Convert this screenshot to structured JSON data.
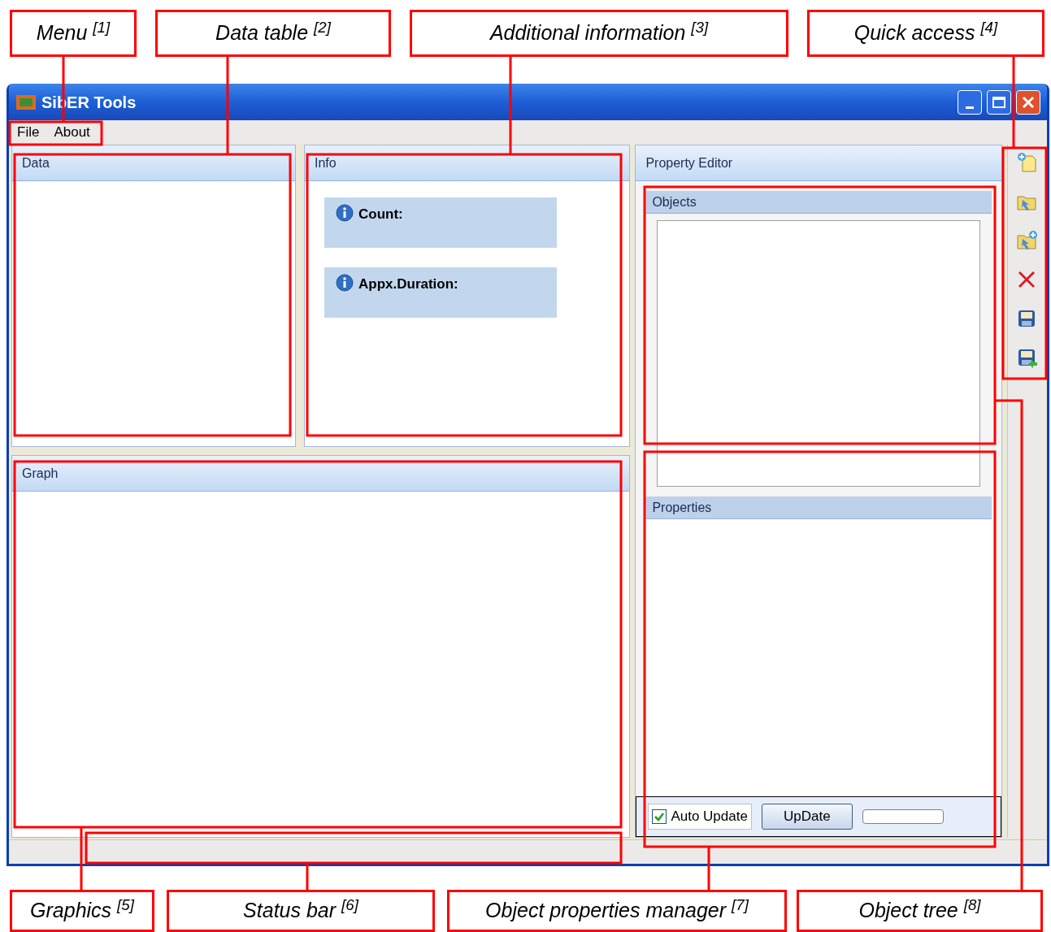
{
  "callouts_top": [
    {
      "text": "Menu $^{[1]}$"
    },
    {
      "text": "Data table $^{[2]}$"
    },
    {
      "text": "Additional information $^{[3]}$"
    },
    {
      "text": "Quick access $^{[4]}$"
    }
  ],
  "window": {
    "title": "SibER Tools"
  },
  "menu": [
    {
      "label": "File"
    },
    {
      "label": "About"
    }
  ],
  "data_panel": {
    "title": "Data"
  },
  "info_panel": {
    "title": "Info",
    "items": [
      {
        "label": "Count:"
      },
      {
        "label": "Appx.Duration:"
      }
    ]
  },
  "graph_panel": {
    "title": "Graph"
  },
  "property_editor": {
    "title": "Property Editor",
    "objects": {
      "title": "Objects"
    },
    "properties": {
      "title": "Properties"
    },
    "auto_update": {
      "label": "Auto Update",
      "checked": true
    },
    "update_button": "UpDate",
    "progress": {
      "level": 0
    }
  },
  "callouts_bottom": [
    {
      "text": "Graphics $^{[5]}$"
    },
    {
      "text": "Status bar $^{[6]}$"
    },
    {
      "text": "Object properties manager $^{[7]}$"
    },
    {
      "text": "Object tree $^{[8]}$"
    }
  ]
}
